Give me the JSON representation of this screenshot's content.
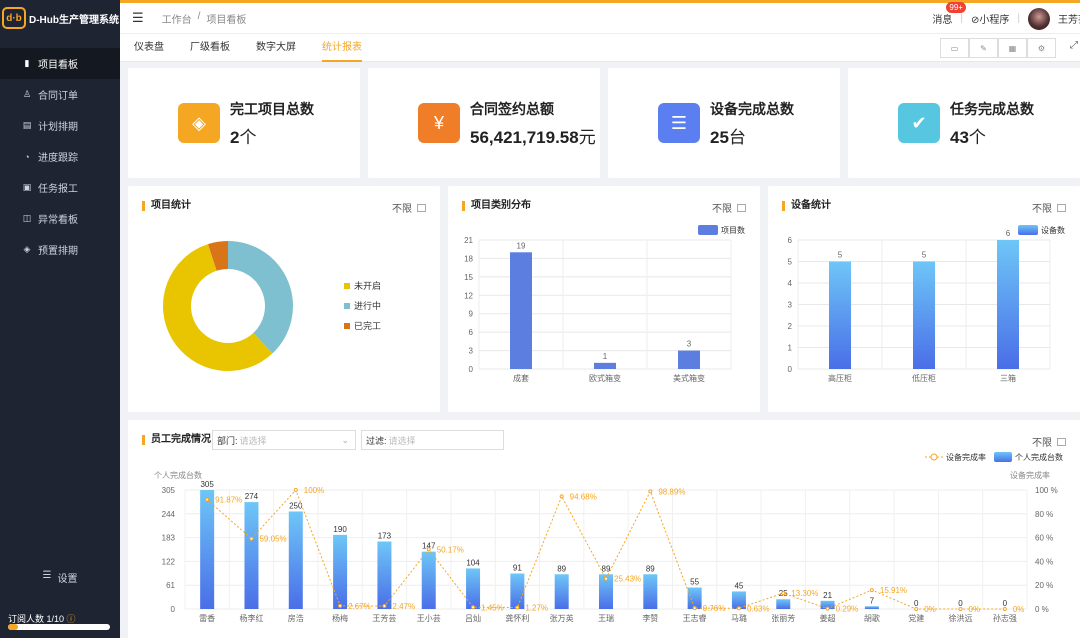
{
  "app": {
    "logo_mark": "d·b",
    "title": "D-Hub生产管理系统"
  },
  "sidebar": {
    "items": [
      {
        "label": "项目看板",
        "icon": "bar-chart-icon",
        "active": true
      },
      {
        "label": "合同订单",
        "icon": "user-icon"
      },
      {
        "label": "计划排期",
        "icon": "calendar-icon"
      },
      {
        "label": "进度跟踪",
        "icon": "progress-icon"
      },
      {
        "label": "任务报工",
        "icon": "task-icon"
      },
      {
        "label": "异常看板",
        "icon": "warning-icon"
      },
      {
        "label": "预置排期",
        "icon": "layers-icon"
      }
    ],
    "settings_label": "设置",
    "subscribers_label": "订阅人数 1/10",
    "subscribers_fraction": 0.1
  },
  "header": {
    "breadcrumb": [
      "工作台",
      "/",
      "项目看板"
    ],
    "messages_label": "消息",
    "messages_badge": "99+",
    "miniprogram_label": "⊘小程序",
    "user_name": "王芳芸"
  },
  "tabs": [
    {
      "label": "仪表盘"
    },
    {
      "label": "厂级看板"
    },
    {
      "label": "数字大屏"
    },
    {
      "label": "统计报表",
      "active": true
    }
  ],
  "kpis": [
    {
      "label": "完工项目总数",
      "value": "2",
      "unit": "个",
      "color": "#f5a623",
      "icon": "layers-icon"
    },
    {
      "label": "合同签约总额",
      "value": "56,421,719.58",
      "unit": "元",
      "color": "#f07d28",
      "icon": "money-bag-icon"
    },
    {
      "label": "设备完成总数",
      "value": "25",
      "unit": "台",
      "color": "#5b7ff0",
      "icon": "document-icon"
    },
    {
      "label": "任务完成总数",
      "value": "43",
      "unit": "个",
      "color": "#57c6e0",
      "icon": "clipboard-check-icon"
    }
  ],
  "filter_label": "不限",
  "project_stats": {
    "title": "项目统计",
    "chart_data": {
      "type": "pie",
      "labels": [
        "未开启",
        "进行中",
        "已完工"
      ],
      "values": [
        57,
        38,
        5
      ],
      "colors": [
        "#e8c500",
        "#7ec0cf",
        "#d97518"
      ]
    }
  },
  "category_dist": {
    "title": "项目类别分布",
    "chart_data": {
      "type": "bar",
      "categories": [
        "成套",
        "欧式箱变",
        "美式箱变"
      ],
      "series": [
        {
          "name": "项目数",
          "values": [
            19,
            1,
            3
          ]
        }
      ],
      "yticks": [
        0,
        3,
        6,
        9,
        12,
        15,
        18,
        21
      ],
      "ylim": [
        0,
        21
      ],
      "color": "#5b7ee0"
    }
  },
  "device_stats": {
    "title": "设备统计",
    "chart_data": {
      "type": "bar",
      "categories": [
        "高压柜",
        "低压柜",
        "三箱"
      ],
      "series": [
        {
          "name": "设备数",
          "values": [
            5,
            5,
            6
          ]
        }
      ],
      "yticks": [
        0,
        1,
        2,
        3,
        4,
        5,
        6
      ],
      "ylim": [
        0,
        6
      ]
    }
  },
  "employee": {
    "title": "员工完成情况",
    "dept_label": "部门:",
    "dept_placeholder": "请选择",
    "filter_label": "过滤:",
    "filter_placeholder": "请选择",
    "chart_data": {
      "type": "bar",
      "categories": [
        "雷香",
        "杨李红",
        "房浩",
        "杨梅",
        "王芳芸",
        "王小芸",
        "吕灿",
        "龚怀利",
        "张万英",
        "王瑞",
        "李赞",
        "王志睿",
        "马璐",
        "张丽芳",
        "姜超",
        "胡歌",
        "党建",
        "徐洪远",
        "孙志强"
      ],
      "ylabel": "个人完成台数",
      "y2label": "设备完成率",
      "yticks": [
        0,
        61,
        122,
        183,
        244,
        305
      ],
      "ylim": [
        0,
        305
      ],
      "y2ticks": [
        "0 %",
        "20 %",
        "40 %",
        "60 %",
        "80 %",
        "100 %"
      ],
      "y2lim": [
        0,
        100
      ],
      "series": [
        {
          "name": "个人完成台数",
          "type": "bar",
          "values": [
            305,
            274,
            250,
            190,
            173,
            147,
            104,
            91,
            89,
            89,
            89,
            55,
            45,
            25,
            21,
            7,
            0,
            0,
            0
          ]
        },
        {
          "name": "设备完成率",
          "type": "line",
          "values": [
            91.87,
            59.05,
            100,
            2.67,
            2.47,
            50.17,
            1.45,
            1.27,
            94.68,
            25.43,
            98.89,
            0.76,
            0.63,
            13.3,
            0.29,
            15.91,
            0,
            0,
            0
          ],
          "labels": [
            "91.87%",
            "59.05%",
            "100%",
            "2.67%",
            "2.47%",
            "50.17%",
            "1.45%",
            "1.27%",
            "94.68%",
            "25.43%",
            "98.89%",
            "0.76%",
            "0.63%",
            "13.30%",
            "0.29%",
            "15.91%",
            "0%",
            "0%",
            "0%"
          ]
        }
      ]
    }
  }
}
